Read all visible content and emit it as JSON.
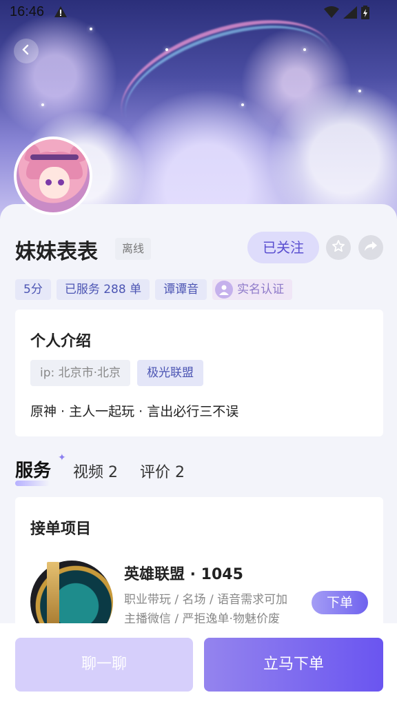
{
  "status_bar": {
    "time": "16:46"
  },
  "profile": {
    "name": "妹妹表表",
    "status": "离线",
    "follow_label": "已关注",
    "tags": [
      "5分",
      "已服务 288 单",
      "谭谭音",
      "实名认证"
    ]
  },
  "intro": {
    "title": "个人介绍",
    "ip": "ip: 北京市·北京",
    "guild": "极光联盟",
    "text": "原神 · 主人一起玩 · 言出必行三不误"
  },
  "tabs": [
    {
      "label": "服务"
    },
    {
      "label": "视频 2"
    },
    {
      "label": "评价 2"
    }
  ],
  "service": {
    "title": "接单项目",
    "game_title": "英雄联盟 · 1045",
    "desc_line1": "职业带玩 / 名场 / 语音需求可加",
    "desc_line2": "主播微信 / 严拒逸单·物魅价废",
    "order_label": "下单"
  },
  "bottom": {
    "chat_label": "聊一聊",
    "buy_label": "立马下单"
  },
  "colors": {
    "accent": "#6a55f0",
    "tag_text": "#4c55b3"
  },
  "icons": [
    "warning-icon",
    "wifi-icon",
    "signal-icon",
    "battery-icon",
    "back-icon",
    "star-icon",
    "share-icon",
    "verify-icon",
    "sparkle-icon"
  ]
}
